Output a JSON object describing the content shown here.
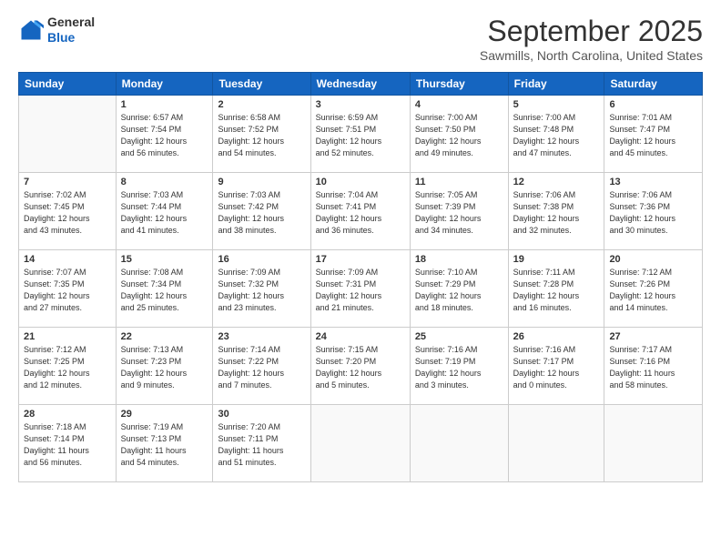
{
  "logo": {
    "general": "General",
    "blue": "Blue"
  },
  "header": {
    "month": "September 2025",
    "location": "Sawmills, North Carolina, United States"
  },
  "weekdays": [
    "Sunday",
    "Monday",
    "Tuesday",
    "Wednesday",
    "Thursday",
    "Friday",
    "Saturday"
  ],
  "weeks": [
    [
      {
        "day": "",
        "info": ""
      },
      {
        "day": "1",
        "info": "Sunrise: 6:57 AM\nSunset: 7:54 PM\nDaylight: 12 hours\nand 56 minutes."
      },
      {
        "day": "2",
        "info": "Sunrise: 6:58 AM\nSunset: 7:52 PM\nDaylight: 12 hours\nand 54 minutes."
      },
      {
        "day": "3",
        "info": "Sunrise: 6:59 AM\nSunset: 7:51 PM\nDaylight: 12 hours\nand 52 minutes."
      },
      {
        "day": "4",
        "info": "Sunrise: 7:00 AM\nSunset: 7:50 PM\nDaylight: 12 hours\nand 49 minutes."
      },
      {
        "day": "5",
        "info": "Sunrise: 7:00 AM\nSunset: 7:48 PM\nDaylight: 12 hours\nand 47 minutes."
      },
      {
        "day": "6",
        "info": "Sunrise: 7:01 AM\nSunset: 7:47 PM\nDaylight: 12 hours\nand 45 minutes."
      }
    ],
    [
      {
        "day": "7",
        "info": "Sunrise: 7:02 AM\nSunset: 7:45 PM\nDaylight: 12 hours\nand 43 minutes."
      },
      {
        "day": "8",
        "info": "Sunrise: 7:03 AM\nSunset: 7:44 PM\nDaylight: 12 hours\nand 41 minutes."
      },
      {
        "day": "9",
        "info": "Sunrise: 7:03 AM\nSunset: 7:42 PM\nDaylight: 12 hours\nand 38 minutes."
      },
      {
        "day": "10",
        "info": "Sunrise: 7:04 AM\nSunset: 7:41 PM\nDaylight: 12 hours\nand 36 minutes."
      },
      {
        "day": "11",
        "info": "Sunrise: 7:05 AM\nSunset: 7:39 PM\nDaylight: 12 hours\nand 34 minutes."
      },
      {
        "day": "12",
        "info": "Sunrise: 7:06 AM\nSunset: 7:38 PM\nDaylight: 12 hours\nand 32 minutes."
      },
      {
        "day": "13",
        "info": "Sunrise: 7:06 AM\nSunset: 7:36 PM\nDaylight: 12 hours\nand 30 minutes."
      }
    ],
    [
      {
        "day": "14",
        "info": "Sunrise: 7:07 AM\nSunset: 7:35 PM\nDaylight: 12 hours\nand 27 minutes."
      },
      {
        "day": "15",
        "info": "Sunrise: 7:08 AM\nSunset: 7:34 PM\nDaylight: 12 hours\nand 25 minutes."
      },
      {
        "day": "16",
        "info": "Sunrise: 7:09 AM\nSunset: 7:32 PM\nDaylight: 12 hours\nand 23 minutes."
      },
      {
        "day": "17",
        "info": "Sunrise: 7:09 AM\nSunset: 7:31 PM\nDaylight: 12 hours\nand 21 minutes."
      },
      {
        "day": "18",
        "info": "Sunrise: 7:10 AM\nSunset: 7:29 PM\nDaylight: 12 hours\nand 18 minutes."
      },
      {
        "day": "19",
        "info": "Sunrise: 7:11 AM\nSunset: 7:28 PM\nDaylight: 12 hours\nand 16 minutes."
      },
      {
        "day": "20",
        "info": "Sunrise: 7:12 AM\nSunset: 7:26 PM\nDaylight: 12 hours\nand 14 minutes."
      }
    ],
    [
      {
        "day": "21",
        "info": "Sunrise: 7:12 AM\nSunset: 7:25 PM\nDaylight: 12 hours\nand 12 minutes."
      },
      {
        "day": "22",
        "info": "Sunrise: 7:13 AM\nSunset: 7:23 PM\nDaylight: 12 hours\nand 9 minutes."
      },
      {
        "day": "23",
        "info": "Sunrise: 7:14 AM\nSunset: 7:22 PM\nDaylight: 12 hours\nand 7 minutes."
      },
      {
        "day": "24",
        "info": "Sunrise: 7:15 AM\nSunset: 7:20 PM\nDaylight: 12 hours\nand 5 minutes."
      },
      {
        "day": "25",
        "info": "Sunrise: 7:16 AM\nSunset: 7:19 PM\nDaylight: 12 hours\nand 3 minutes."
      },
      {
        "day": "26",
        "info": "Sunrise: 7:16 AM\nSunset: 7:17 PM\nDaylight: 12 hours\nand 0 minutes."
      },
      {
        "day": "27",
        "info": "Sunrise: 7:17 AM\nSunset: 7:16 PM\nDaylight: 11 hours\nand 58 minutes."
      }
    ],
    [
      {
        "day": "28",
        "info": "Sunrise: 7:18 AM\nSunset: 7:14 PM\nDaylight: 11 hours\nand 56 minutes."
      },
      {
        "day": "29",
        "info": "Sunrise: 7:19 AM\nSunset: 7:13 PM\nDaylight: 11 hours\nand 54 minutes."
      },
      {
        "day": "30",
        "info": "Sunrise: 7:20 AM\nSunset: 7:11 PM\nDaylight: 11 hours\nand 51 minutes."
      },
      {
        "day": "",
        "info": ""
      },
      {
        "day": "",
        "info": ""
      },
      {
        "day": "",
        "info": ""
      },
      {
        "day": "",
        "info": ""
      }
    ]
  ]
}
